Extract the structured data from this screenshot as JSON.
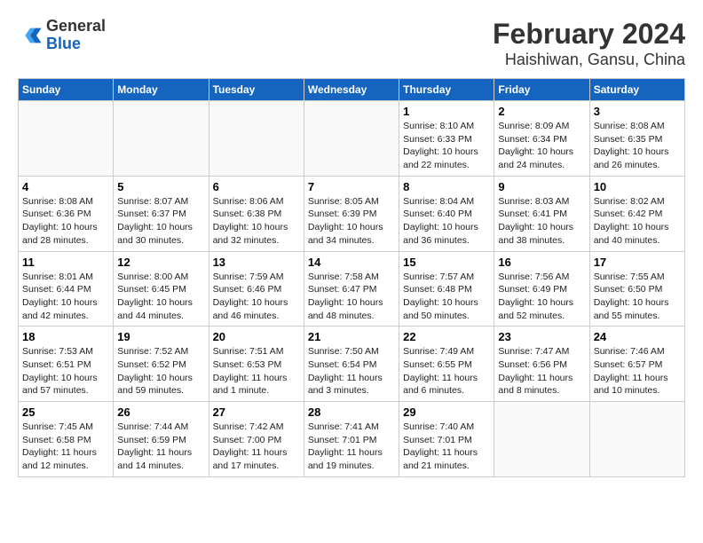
{
  "header": {
    "logo_general": "General",
    "logo_blue": "Blue",
    "title": "February 2024",
    "subtitle": "Haishiwan, Gansu, China"
  },
  "days_of_week": [
    "Sunday",
    "Monday",
    "Tuesday",
    "Wednesday",
    "Thursday",
    "Friday",
    "Saturday"
  ],
  "weeks": [
    [
      {
        "num": "",
        "info": ""
      },
      {
        "num": "",
        "info": ""
      },
      {
        "num": "",
        "info": ""
      },
      {
        "num": "",
        "info": ""
      },
      {
        "num": "1",
        "info": "Sunrise: 8:10 AM\nSunset: 6:33 PM\nDaylight: 10 hours\nand 22 minutes."
      },
      {
        "num": "2",
        "info": "Sunrise: 8:09 AM\nSunset: 6:34 PM\nDaylight: 10 hours\nand 24 minutes."
      },
      {
        "num": "3",
        "info": "Sunrise: 8:08 AM\nSunset: 6:35 PM\nDaylight: 10 hours\nand 26 minutes."
      }
    ],
    [
      {
        "num": "4",
        "info": "Sunrise: 8:08 AM\nSunset: 6:36 PM\nDaylight: 10 hours\nand 28 minutes."
      },
      {
        "num": "5",
        "info": "Sunrise: 8:07 AM\nSunset: 6:37 PM\nDaylight: 10 hours\nand 30 minutes."
      },
      {
        "num": "6",
        "info": "Sunrise: 8:06 AM\nSunset: 6:38 PM\nDaylight: 10 hours\nand 32 minutes."
      },
      {
        "num": "7",
        "info": "Sunrise: 8:05 AM\nSunset: 6:39 PM\nDaylight: 10 hours\nand 34 minutes."
      },
      {
        "num": "8",
        "info": "Sunrise: 8:04 AM\nSunset: 6:40 PM\nDaylight: 10 hours\nand 36 minutes."
      },
      {
        "num": "9",
        "info": "Sunrise: 8:03 AM\nSunset: 6:41 PM\nDaylight: 10 hours\nand 38 minutes."
      },
      {
        "num": "10",
        "info": "Sunrise: 8:02 AM\nSunset: 6:42 PM\nDaylight: 10 hours\nand 40 minutes."
      }
    ],
    [
      {
        "num": "11",
        "info": "Sunrise: 8:01 AM\nSunset: 6:44 PM\nDaylight: 10 hours\nand 42 minutes."
      },
      {
        "num": "12",
        "info": "Sunrise: 8:00 AM\nSunset: 6:45 PM\nDaylight: 10 hours\nand 44 minutes."
      },
      {
        "num": "13",
        "info": "Sunrise: 7:59 AM\nSunset: 6:46 PM\nDaylight: 10 hours\nand 46 minutes."
      },
      {
        "num": "14",
        "info": "Sunrise: 7:58 AM\nSunset: 6:47 PM\nDaylight: 10 hours\nand 48 minutes."
      },
      {
        "num": "15",
        "info": "Sunrise: 7:57 AM\nSunset: 6:48 PM\nDaylight: 10 hours\nand 50 minutes."
      },
      {
        "num": "16",
        "info": "Sunrise: 7:56 AM\nSunset: 6:49 PM\nDaylight: 10 hours\nand 52 minutes."
      },
      {
        "num": "17",
        "info": "Sunrise: 7:55 AM\nSunset: 6:50 PM\nDaylight: 10 hours\nand 55 minutes."
      }
    ],
    [
      {
        "num": "18",
        "info": "Sunrise: 7:53 AM\nSunset: 6:51 PM\nDaylight: 10 hours\nand 57 minutes."
      },
      {
        "num": "19",
        "info": "Sunrise: 7:52 AM\nSunset: 6:52 PM\nDaylight: 10 hours\nand 59 minutes."
      },
      {
        "num": "20",
        "info": "Sunrise: 7:51 AM\nSunset: 6:53 PM\nDaylight: 11 hours\nand 1 minute."
      },
      {
        "num": "21",
        "info": "Sunrise: 7:50 AM\nSunset: 6:54 PM\nDaylight: 11 hours\nand 3 minutes."
      },
      {
        "num": "22",
        "info": "Sunrise: 7:49 AM\nSunset: 6:55 PM\nDaylight: 11 hours\nand 6 minutes."
      },
      {
        "num": "23",
        "info": "Sunrise: 7:47 AM\nSunset: 6:56 PM\nDaylight: 11 hours\nand 8 minutes."
      },
      {
        "num": "24",
        "info": "Sunrise: 7:46 AM\nSunset: 6:57 PM\nDaylight: 11 hours\nand 10 minutes."
      }
    ],
    [
      {
        "num": "25",
        "info": "Sunrise: 7:45 AM\nSunset: 6:58 PM\nDaylight: 11 hours\nand 12 minutes."
      },
      {
        "num": "26",
        "info": "Sunrise: 7:44 AM\nSunset: 6:59 PM\nDaylight: 11 hours\nand 14 minutes."
      },
      {
        "num": "27",
        "info": "Sunrise: 7:42 AM\nSunset: 7:00 PM\nDaylight: 11 hours\nand 17 minutes."
      },
      {
        "num": "28",
        "info": "Sunrise: 7:41 AM\nSunset: 7:01 PM\nDaylight: 11 hours\nand 19 minutes."
      },
      {
        "num": "29",
        "info": "Sunrise: 7:40 AM\nSunset: 7:01 PM\nDaylight: 11 hours\nand 21 minutes."
      },
      {
        "num": "",
        "info": ""
      },
      {
        "num": "",
        "info": ""
      }
    ]
  ]
}
